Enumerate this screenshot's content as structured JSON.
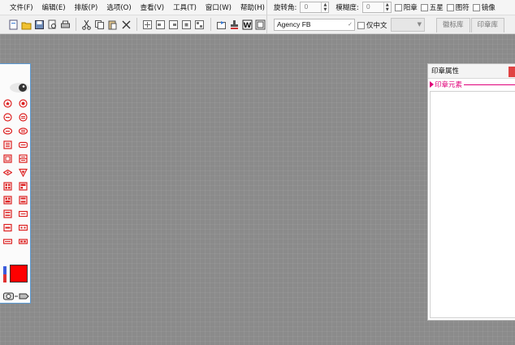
{
  "menu": [
    "文件(F)",
    "编辑(E)",
    "排版(P)",
    "选项(O)",
    "查看(V)",
    "工具(T)",
    "窗口(W)",
    "帮助(H)"
  ],
  "controls": {
    "rotation_label": "旋转角:",
    "rotation_value": "0",
    "blur_label": "模糊度:",
    "blur_value": "0",
    "checks": [
      "阳章",
      "五星",
      "图符",
      "镜像"
    ]
  },
  "toolbar_icons": [
    "new-icon",
    "open-icon",
    "save-icon",
    "print-preview-icon",
    "print-icon",
    "cut-icon",
    "copy-icon",
    "paste-icon",
    "delete-icon",
    "align-icon",
    "align-left-icon",
    "align-right-icon",
    "align-center-icon",
    "layer-icon",
    "export-icon",
    "stamp-icon",
    "word-icon",
    "fit-icon"
  ],
  "font": {
    "name": "Agency FB",
    "chinese_only_label": "仅中文"
  },
  "tabs": [
    "徽标库",
    "印章库"
  ],
  "palette": {
    "swatch_color": "#ff0000"
  },
  "props_panel": {
    "title": "印章属性",
    "section": "印章元素"
  }
}
